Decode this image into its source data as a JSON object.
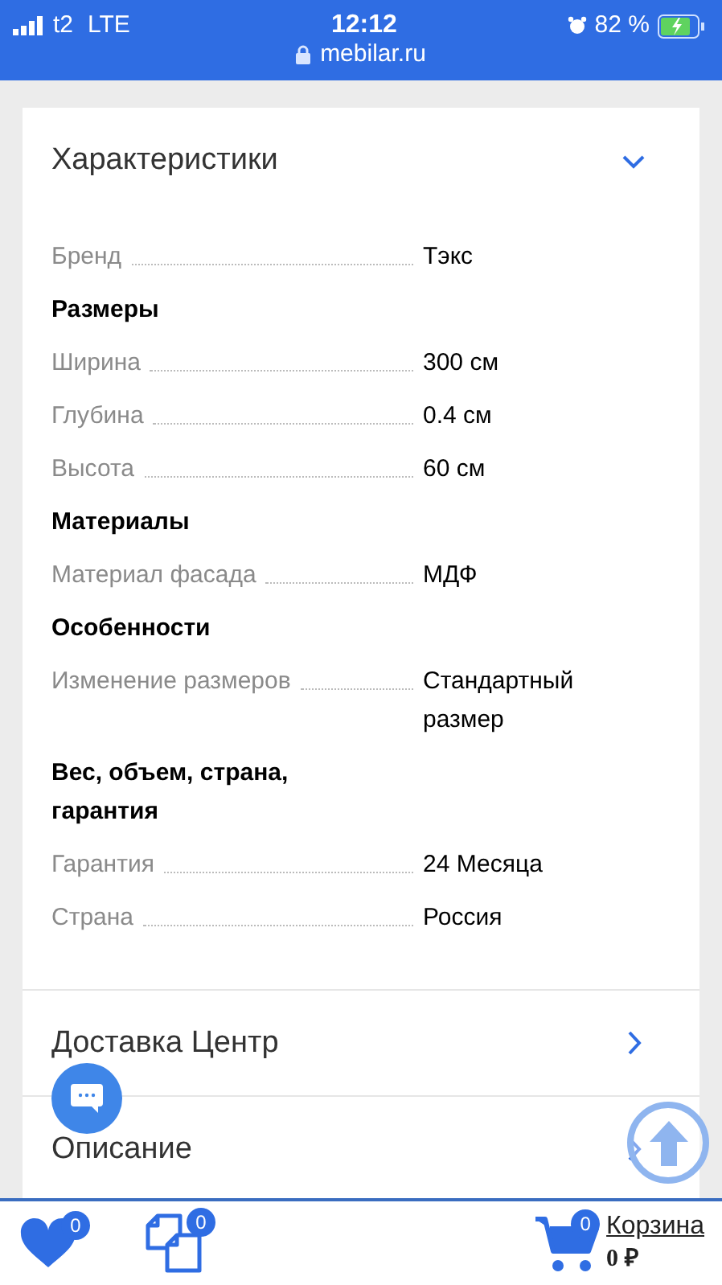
{
  "status_bar": {
    "carrier": "t2",
    "network": "LTE",
    "time": "12:12",
    "url": "mebilar.ru",
    "battery": "82 %",
    "alarm": true,
    "charging": true
  },
  "specs": {
    "title": "Характеристики",
    "expanded": true,
    "rows": [
      {
        "kind": "pair",
        "label": "Бренд",
        "value": "Тэкс"
      },
      {
        "kind": "group",
        "label": "Размеры"
      },
      {
        "kind": "pair",
        "label": "Ширина",
        "value": "300 см"
      },
      {
        "kind": "pair",
        "label": "Глубина",
        "value": "0.4 см"
      },
      {
        "kind": "pair",
        "label": "Высота",
        "value": "60 см"
      },
      {
        "kind": "group",
        "label": "Материалы"
      },
      {
        "kind": "pair",
        "label": "Материал фасада",
        "value": "МДФ"
      },
      {
        "kind": "group",
        "label": "Особенности"
      },
      {
        "kind": "pair",
        "label": "Изменение размеров",
        "value": "Стандартный размер"
      },
      {
        "kind": "group",
        "label": "Вес, объем, страна, гарантия"
      },
      {
        "kind": "pair",
        "label": "Гарантия",
        "value": "24 Месяца"
      },
      {
        "kind": "pair",
        "label": "Страна",
        "value": "Россия"
      }
    ]
  },
  "sections": [
    {
      "title": "Доставка Центр"
    },
    {
      "title": "Описание"
    }
  ],
  "bottom_bar": {
    "favorites_count": "0",
    "compare_count": "0",
    "cart_count": "0",
    "cart_label": "Корзина",
    "cart_total": "0 ₽"
  }
}
